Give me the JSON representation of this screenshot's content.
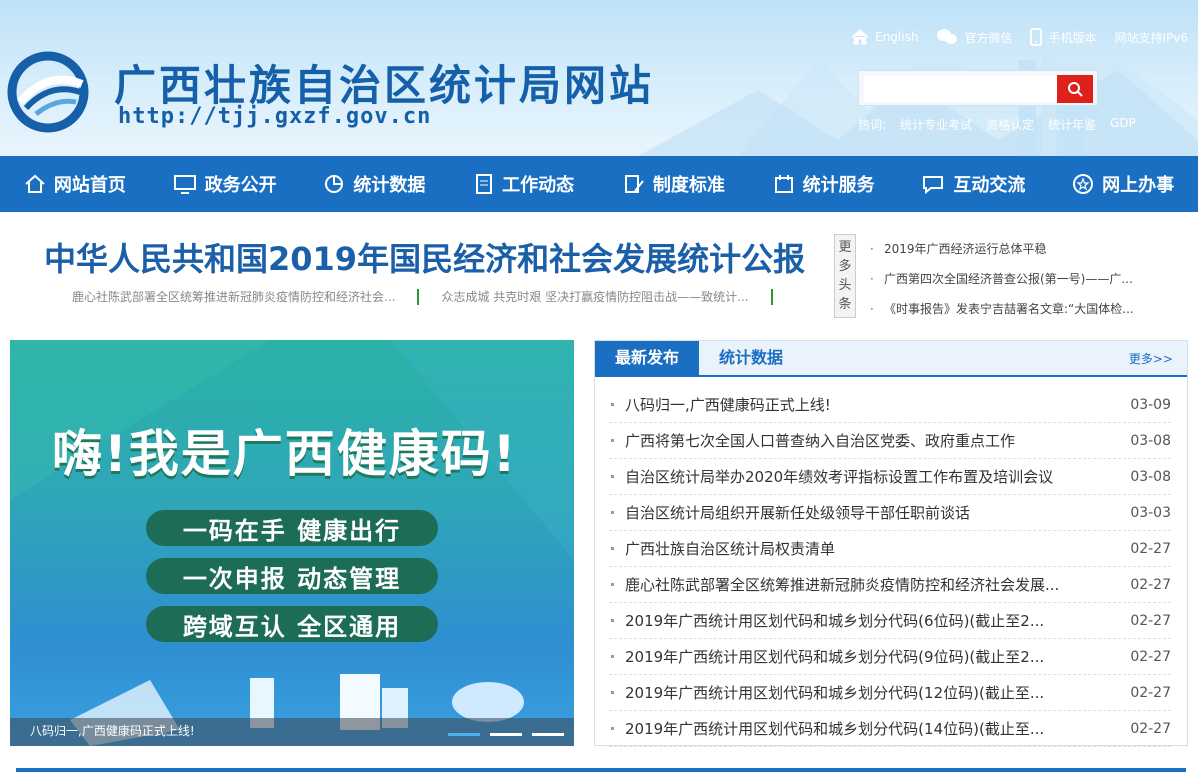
{
  "header": {
    "title": "广西壮族自治区统计局网站",
    "url": "http://tjj.gxzf.gov.cn",
    "top_links": [
      {
        "icon": "home-icon",
        "label": "English"
      },
      {
        "icon": "wechat-icon",
        "label": "官方微信"
      },
      {
        "icon": "mobile-icon",
        "label": "手机版本"
      },
      {
        "icon": "",
        "label": "网站支持IPv6"
      }
    ],
    "search": {
      "placeholder": "",
      "value": ""
    },
    "hot_label": "热词:",
    "hot_words": [
      "统计专业考试",
      "资格认定",
      "统计年鉴",
      "GDP"
    ]
  },
  "nav": [
    {
      "icon": "home-icon",
      "label": "网站首页"
    },
    {
      "icon": "monitor-icon",
      "label": "政务公开"
    },
    {
      "icon": "pie-chart-icon",
      "label": "统计数据"
    },
    {
      "icon": "document-icon",
      "label": "工作动态"
    },
    {
      "icon": "edit-icon",
      "label": "制度标准"
    },
    {
      "icon": "calendar-icon",
      "label": "统计服务"
    },
    {
      "icon": "chat-icon",
      "label": "互动交流"
    },
    {
      "icon": "star-icon",
      "label": "网上办事"
    }
  ],
  "headline": {
    "title": "中华人民共和国2019年国民经济和社会发展统计公报",
    "sub_links": [
      "鹿心社陈武部署全区统筹推进新冠肺炎疫情防控和经济社会...",
      "众志成城 共克时艰 坚决打赢疫情防控阻击战——致统计..."
    ]
  },
  "more_headlines": {
    "label": "更多头条",
    "chars": [
      "更",
      "多",
      "头",
      "条"
    ],
    "items": [
      "2019年广西经济运行总体平稳",
      "广西第四次全国经济普查公报(第一号)——广...",
      "《时事报告》发表宁吉喆署名文章:“大国体检..."
    ]
  },
  "carousel": {
    "slide_title": "嗨!我是广西健康码!",
    "pills": [
      "一码在手  健康出行",
      "一次申报  动态管理",
      "跨域互认  全区通用"
    ],
    "caption": "八码归一,广西健康码正式上线!",
    "dots": 3,
    "active_dot": 0
  },
  "news_panel": {
    "tabs": [
      "最新发布",
      "统计数据"
    ],
    "more": "更多>>",
    "items": [
      {
        "title": "八码归一,广西健康码正式上线!",
        "date": "03-09"
      },
      {
        "title": "广西将第七次全国人口普查纳入自治区党委、政府重点工作",
        "date": "03-08"
      },
      {
        "title": "自治区统计局举办2020年绩效考评指标设置工作布置及培训会议",
        "date": "03-08"
      },
      {
        "title": "自治区统计局组织开展新任处级领导干部任职前谈话",
        "date": "03-03"
      },
      {
        "title": "广西壮族自治区统计局权责清单",
        "date": "02-27"
      },
      {
        "title": "鹿心社陈武部署全区统筹推进新冠肺炎疫情防控和经济社会发展...",
        "date": "02-27"
      },
      {
        "title": "2019年广西统计用区划代码和城乡划分代码(6位码)(截止至2...",
        "date": "02-27"
      },
      {
        "title": "2019年广西统计用区划代码和城乡划分代码(9位码)(截止至2...",
        "date": "02-27"
      },
      {
        "title": "2019年广西统计用区划代码和城乡划分代码(12位码)(截止至...",
        "date": "02-27"
      },
      {
        "title": "2019年广西统计用区划代码和城乡划分代码(14位码)(截止至...",
        "date": "02-27"
      }
    ]
  },
  "colors": {
    "primary": "#1a6fc3",
    "headline": "#1a5fa8",
    "search_button": "#e0201a"
  }
}
